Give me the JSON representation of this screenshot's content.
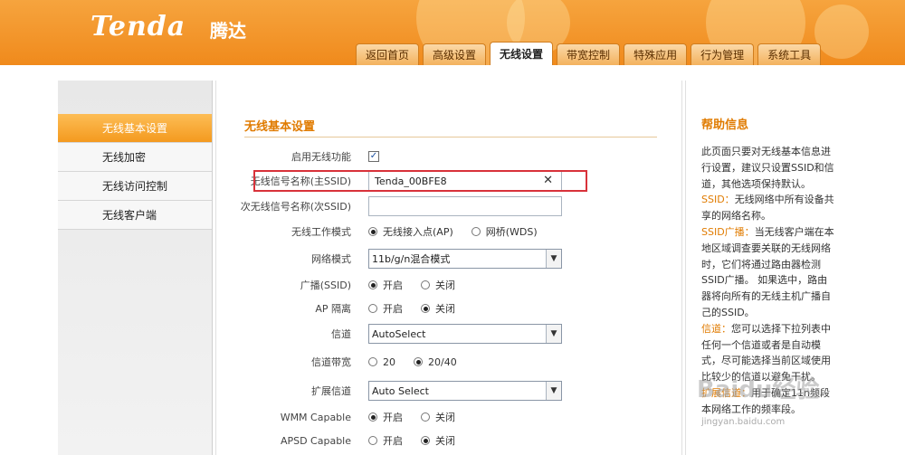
{
  "brand": {
    "logo": "Tenda",
    "logo_cn": "腾达"
  },
  "nav": [
    "返回首页",
    "高级设置",
    "无线设置",
    "带宽控制",
    "特殊应用",
    "行为管理",
    "系统工具"
  ],
  "nav_active": "无线设置",
  "sidebar": {
    "items": [
      {
        "label": "无线基本设置",
        "active": true
      },
      {
        "label": "无线加密",
        "active": false
      },
      {
        "label": "无线访问控制",
        "active": false
      },
      {
        "label": "无线客户端",
        "active": false
      }
    ]
  },
  "main": {
    "title": "无线基本设置",
    "enable_wireless_label": "启用无线功能",
    "enable_wireless_checked": true,
    "ssid_label": "无线信号名称(主SSID)",
    "ssid_value": "Tenda_00BFE8",
    "ssid2_label": "次无线信号名称(次SSID)",
    "ssid2_value": "",
    "mode_label": "无线工作模式",
    "mode_ap": "无线接入点(AP)",
    "mode_wds": "网桥(WDS)",
    "mode_selected": "ap",
    "netmode_label": "网络模式",
    "netmode_value": "11b/g/n混合模式",
    "broadcast_label": "广播(SSID)",
    "on_label": "开启",
    "off_label": "关闭",
    "broadcast_value": "on",
    "apiso_label": "AP 隔离",
    "apiso_value": "off",
    "channel_label": "信道",
    "channel_value": "AutoSelect",
    "bandwidth_label": "信道带宽",
    "bw_20": "20",
    "bw_2040": "20/40",
    "bandwidth_value": "20/40",
    "ext_channel_label": "扩展信道",
    "ext_channel_value": "Auto Select",
    "wmm_label": "WMM Capable",
    "wmm_value": "on",
    "apsd_label": "APSD Capable",
    "apsd_value": "off"
  },
  "help": {
    "title": "帮助信息",
    "p1": "此页面只要对无线基本信息进行设置，建议只设置SSID和信道，其他选项保持默认。",
    "ssid_term": "SSID：",
    "ssid_text": "无线网络中所有设备共享的网络名称。",
    "bcast_term": "SSID广播：",
    "bcast_text": "当无线客户端在本地区域调查要关联的无线网络时，它们将通过路由器检测SSID广播。 如果选中，路由器将向所有的无线主机广播自己的SSID。",
    "chan_term": "信道：",
    "chan_text": "您可以选择下拉列表中任何一个信道或者是自动模式，尽可能选择当前区域使用比较少的信道以避免干扰。",
    "ext_term": "扩展信道：",
    "ext_text": "用于确定11n频段本网络工作的频率段。"
  },
  "watermark": {
    "text": "Baidu经验",
    "url": "jingyan.baidu.com"
  },
  "colors": {
    "accent": "#f08a1c",
    "highlight_box": "#d8323a"
  }
}
